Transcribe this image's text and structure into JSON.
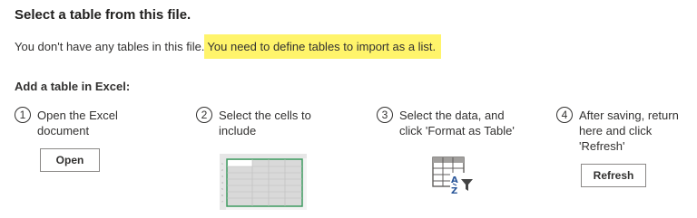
{
  "title": "Select a table from this file.",
  "message": {
    "plain": "You don't have any tables in this file.",
    "highlighted": "You need to define tables to import as a list."
  },
  "section_heading": "Add a table in Excel:",
  "steps": [
    {
      "number": "1",
      "lines": [
        "Open the Excel",
        "document"
      ],
      "button": "Open"
    },
    {
      "number": "2",
      "lines": [
        "Select the cells to",
        "include"
      ],
      "illustration": "excel-selected-cells"
    },
    {
      "number": "3",
      "lines": [
        "Select the data, and",
        "click 'Format as Table'"
      ],
      "icon": "format-as-table-icon"
    },
    {
      "number": "4",
      "lines": [
        "After saving, return",
        "here and click",
        "'Refresh'"
      ],
      "button": "Refresh"
    }
  ],
  "colors": {
    "highlight": "#fff46b",
    "text": "#323130",
    "selection_border": "#3c9a5f",
    "selection_fill": "#d9d9d9",
    "icon_blue": "#2b579a"
  }
}
